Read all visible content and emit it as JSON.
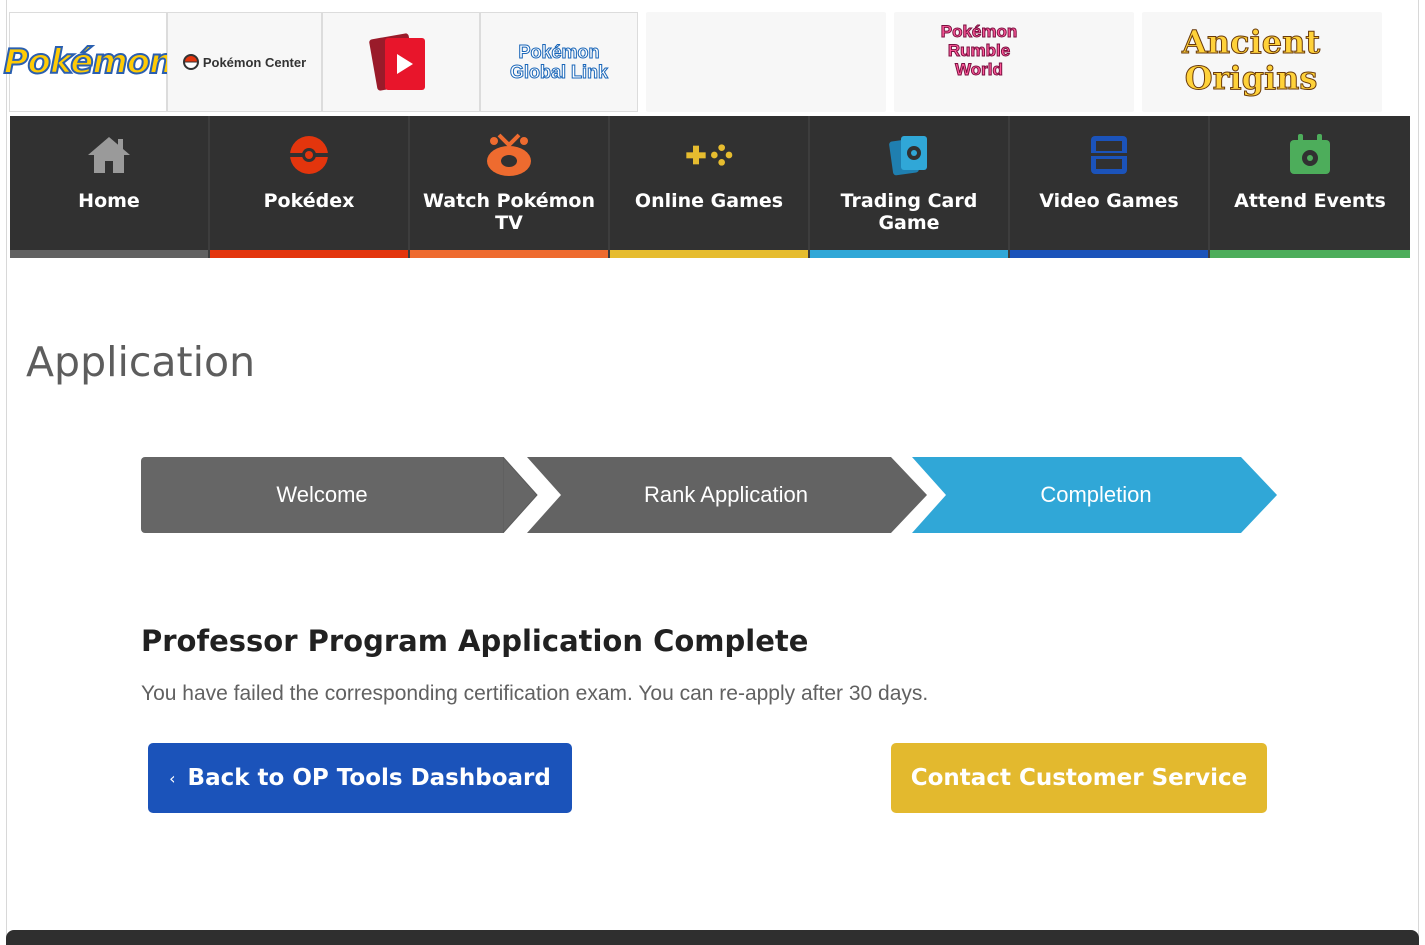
{
  "header": {
    "logos": {
      "pokemon": "Pokémon",
      "pokemon_center": "Pokémon Center",
      "global_link_line1": "Pokémon",
      "global_link_line2": "Global Link"
    },
    "banners": {
      "ancient_line1": "Ancient",
      "ancient_line2": "Origins",
      "rumble_line1": "Pokémon",
      "rumble_line2": "Rumble",
      "rumble_line3": "World"
    }
  },
  "nav": {
    "items": [
      {
        "label": "Home",
        "color": "#616161"
      },
      {
        "label": "Pokédex",
        "color": "#e3350d"
      },
      {
        "label": "Watch Pokémon TV",
        "color": "#ee6b2f"
      },
      {
        "label": "Online Games",
        "color": "#e6bc2f"
      },
      {
        "label": "Trading Card Game",
        "color": "#30a7d7"
      },
      {
        "label": "Video Games",
        "color": "#1b53ba"
      },
      {
        "label": "Attend Events",
        "color": "#4dad5b"
      }
    ]
  },
  "page": {
    "title": "Application"
  },
  "stepper": {
    "steps": [
      "Welcome",
      "Rank Application",
      "Completion"
    ],
    "active": "Completion",
    "active_color": "#30a7d7"
  },
  "content": {
    "heading": "Professor Program Application Complete",
    "message": "You have failed the corresponding certification exam. You can re-apply after 30 days."
  },
  "buttons": {
    "back_label": "Back to OP Tools Dashboard",
    "back_chevron": "‹",
    "contact_label": "Contact Customer Service"
  }
}
